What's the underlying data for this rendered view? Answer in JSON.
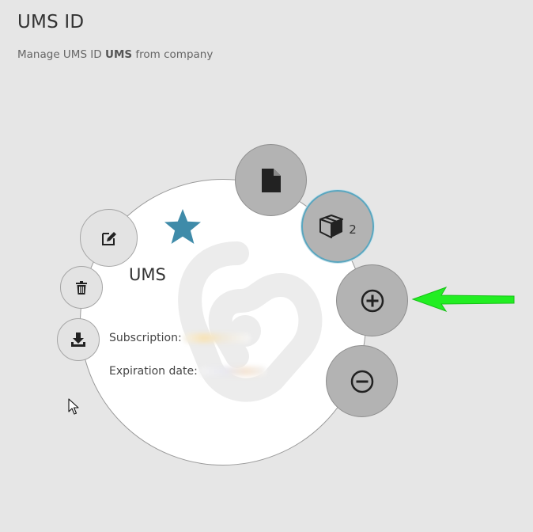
{
  "header": {
    "title": "UMS ID",
    "subtitle_prefix": "Manage UMS ID ",
    "subtitle_bold": "UMS",
    "subtitle_suffix": " from company"
  },
  "organization": {
    "name": "UMS",
    "is_favorite": true,
    "subscription_label": "Subscription:",
    "expiration_label": "Expiration date:"
  },
  "actions": {
    "package_count": "2"
  },
  "icons": {
    "star": "star-icon",
    "edit": "pencil-square-icon",
    "delete": "trash-icon",
    "download": "download-tray-icon",
    "document": "file-icon",
    "package": "package-box-icon",
    "add": "plus-circle-icon",
    "remove": "minus-circle-icon",
    "watermark": "brand-logo",
    "annotation": "arrow-left-icon"
  },
  "colors": {
    "background": "#e6e6e6",
    "star": "#3f8ba9",
    "package_ring": "#5aa6bf",
    "annotation_arrow": "#22ee22",
    "button_dark": "#b3b3b3",
    "button_light": "#e3e3e3"
  }
}
